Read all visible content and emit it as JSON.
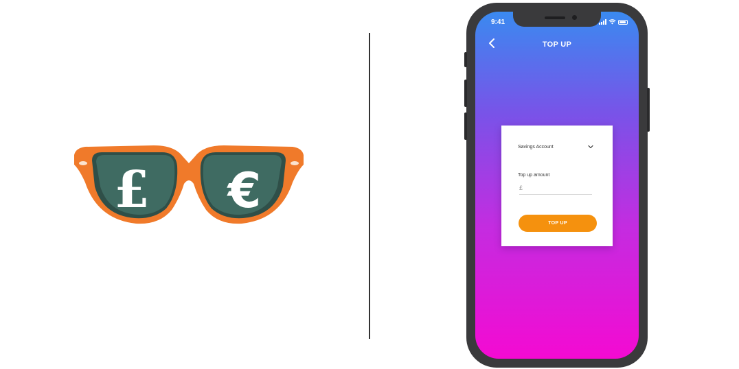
{
  "illustration": {
    "left_lens_symbol": "£",
    "right_lens_symbol": "€",
    "frame_color": "#f07a2a",
    "lens_color": "#3f6b62"
  },
  "status_bar": {
    "time": "9:41"
  },
  "header": {
    "back_icon": "chevron-left-icon",
    "title": "TOP UP"
  },
  "form": {
    "account_select": {
      "selected": "Savings Account",
      "icon": "chevron-down-icon"
    },
    "amount_label": "Top up amount",
    "amount_placeholder": "£",
    "submit_label": "TOP UP"
  },
  "colors": {
    "gradient_top": "#3a8af0",
    "gradient_bottom": "#f40ad2",
    "button": "#f5910e"
  }
}
